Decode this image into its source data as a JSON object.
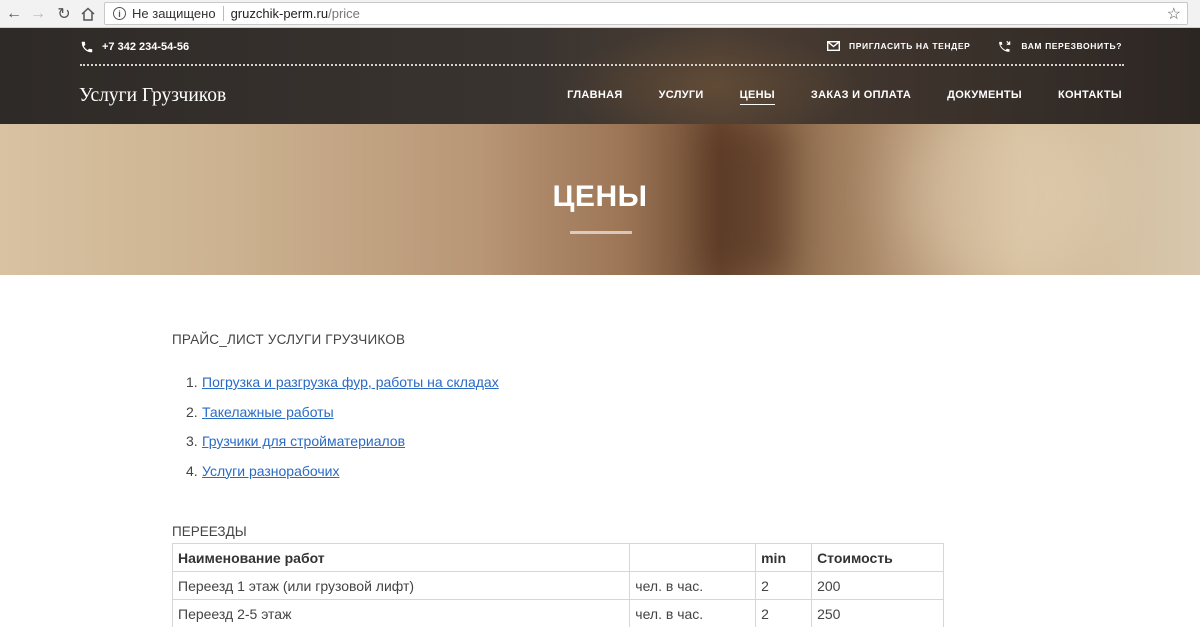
{
  "browser": {
    "security_label": "Не защищено",
    "url_domain": "gruzchik-perm.ru",
    "url_path": "/price"
  },
  "header": {
    "phone": "+7 342 234-54-56",
    "tender_link": "ПРИГЛАСИТЬ НА ТЕНДЕР",
    "callback_link": "ВАМ ПЕРЕЗВОНИТЬ?",
    "logo": "Услуги Грузчиков",
    "nav": [
      {
        "label": "ГЛАВНАЯ"
      },
      {
        "label": "УСЛУГИ"
      },
      {
        "label": "ЦЕНЫ"
      },
      {
        "label": "ЗАКАЗ И ОПЛАТА"
      },
      {
        "label": "ДОКУМЕНТЫ"
      },
      {
        "label": "КОНТАКТЫ"
      }
    ]
  },
  "hero": {
    "title": "ЦЕНЫ"
  },
  "content": {
    "price_title": "ПРАЙС_ЛИСТ УСЛУГИ ГРУЗЧИКОВ",
    "links": [
      {
        "num": "1.",
        "label": "Погрузка и разгрузка фур, работы на складах"
      },
      {
        "num": "2.",
        "label": "Такелажные работы"
      },
      {
        "num": "3.",
        "label": "Грузчики для стройматериалов"
      },
      {
        "num": "4.",
        "label": "Услуги разнорабочих"
      }
    ],
    "section_title": "ПЕРЕЕЗДЫ",
    "table": {
      "headers": [
        "Наименование работ",
        "",
        "min",
        "Стоимость"
      ],
      "rows": [
        [
          "Переезд 1 этаж (или грузовой лифт)",
          "чел. в час.",
          "2",
          "200"
        ],
        [
          "Переезд 2-5 этаж",
          "чел. в час.",
          "2",
          "250"
        ]
      ]
    }
  }
}
